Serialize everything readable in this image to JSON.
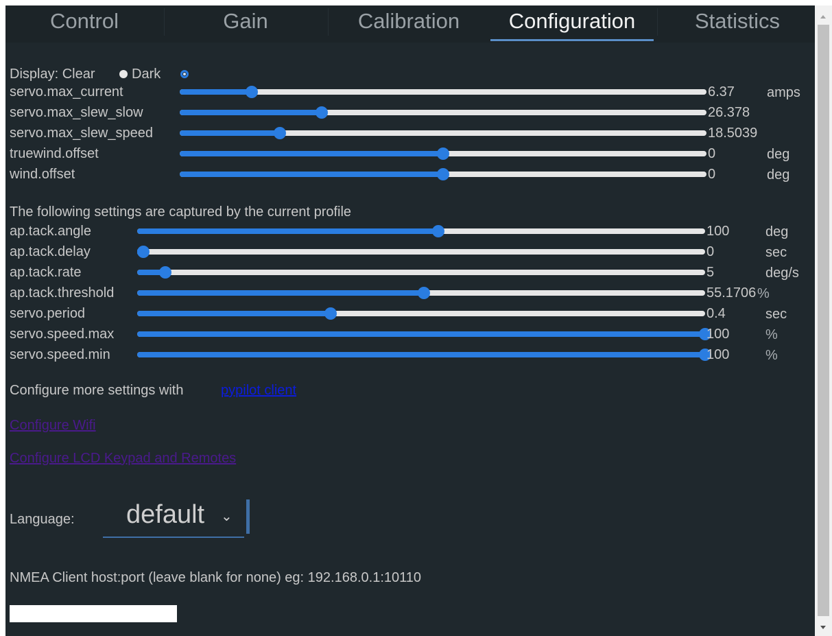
{
  "tabs": [
    {
      "label": "Control"
    },
    {
      "label": "Gain"
    },
    {
      "label": "Calibration"
    },
    {
      "label": "Configuration"
    },
    {
      "label": "Statistics"
    }
  ],
  "active_tab": "Configuration",
  "display": {
    "label": "Display: Clear",
    "dark_label": "Dark",
    "selected": "Dark"
  },
  "settings": [
    {
      "name": "servo.max_current",
      "value": "6.37",
      "unit": "amps",
      "level": 0.137
    },
    {
      "name": "servo.max_slew_slow",
      "value": "26.378",
      "unit": "",
      "level": 0.27
    },
    {
      "name": "servo.max_slew_speed",
      "value": "18.5039",
      "unit": "",
      "level": 0.19
    },
    {
      "name": "truewind.offset",
      "value": "0",
      "unit": "deg",
      "level": 0.5
    },
    {
      "name": "wind.offset",
      "value": "0",
      "unit": "deg",
      "level": 0.5
    }
  ],
  "profile_heading": "The following settings are captured by the current profile",
  "profile_settings": [
    {
      "name": "ap.tack.angle",
      "value": "100",
      "unit": "deg",
      "level": 0.53
    },
    {
      "name": "ap.tack.delay",
      "value": "0",
      "unit": "sec",
      "level": 0.0
    },
    {
      "name": "ap.tack.rate",
      "value": "5",
      "unit": "deg/s",
      "level": 0.05
    },
    {
      "name": "ap.tack.threshold",
      "value": "55.1706",
      "unit": "%",
      "level": 0.505
    },
    {
      "name": "servo.period",
      "value": "0.4",
      "unit": "sec",
      "level": 0.34
    },
    {
      "name": "servo.speed.max",
      "value": "100",
      "unit": "%",
      "level": 1.0
    },
    {
      "name": "servo.speed.min",
      "value": "100",
      "unit": "%",
      "level": 1.0
    }
  ],
  "more_settings": {
    "text": "Configure more settings with",
    "link": "pypilot client"
  },
  "links": {
    "wifi": "Configure Wifi",
    "lcd": "Configure LCD Keypad and Remotes"
  },
  "language": {
    "label": "Language:",
    "value": "default"
  },
  "nmea": {
    "label": "NMEA Client host:port (leave blank for none) eg: 192.168.0.1:10110",
    "value": ""
  },
  "colors": {
    "background": "#1f282d",
    "accent": "#2a7de1",
    "track": "#e6e6e6",
    "text": "#c8c8c8"
  }
}
